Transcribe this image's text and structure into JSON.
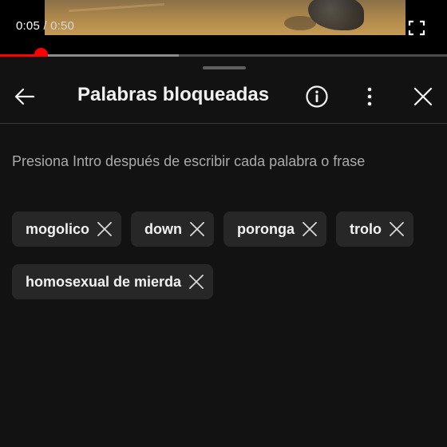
{
  "player": {
    "current_time": "0:05",
    "separator": " / ",
    "duration": "0:50",
    "progress_played_fraction": 0.091,
    "progress_buffered_fraction": 0.4,
    "fullscreen_icon": "fullscreen-icon"
  },
  "header": {
    "title": "Palabras bloqueadas",
    "back_icon": "arrow-left-icon",
    "info_icon": "info-icon",
    "more_icon": "more-vert-icon",
    "close_icon": "close-icon"
  },
  "hint": "Presiona Intro después de escribir cada palabra o frase",
  "blocked_words": [
    {
      "label": "mogolico"
    },
    {
      "label": "down"
    },
    {
      "label": "poronga"
    },
    {
      "label": "trolo"
    },
    {
      "label": "homosexual de mierda"
    }
  ],
  "colors": {
    "background": "#121212",
    "chip": "#272727",
    "accent_red": "#ff0000",
    "hint_text": "#aaaaaa"
  }
}
